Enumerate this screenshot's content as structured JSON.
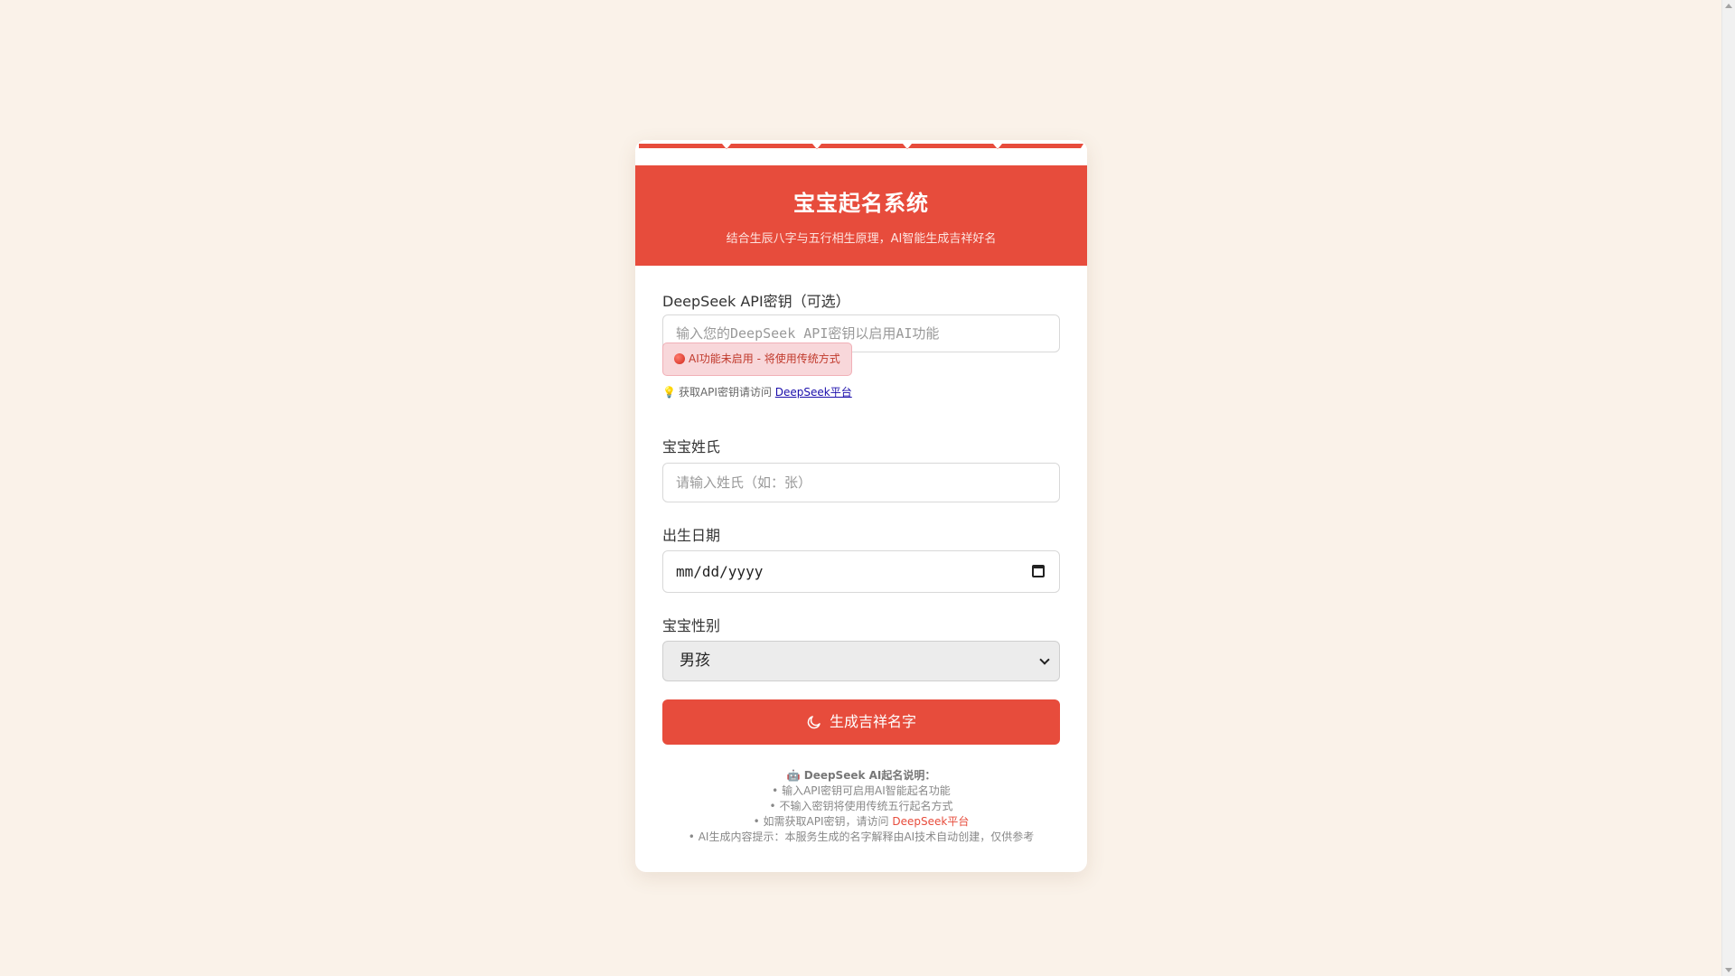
{
  "header": {
    "title": "宝宝起名系统",
    "subtitle": "结合生辰八字与五行相生原理，AI智能生成吉祥好名"
  },
  "api_key": {
    "label": "DeepSeek API密钥（可选）",
    "placeholder": "输入您的DeepSeek API密钥以启用AI功能",
    "status_text": "AI功能未启用 - 将使用传统方式",
    "hint_prefix": "获取API密钥请访问",
    "hint_link": "DeepSeek平台"
  },
  "surname": {
    "label": "宝宝姓氏",
    "placeholder": "请输入姓氏（如：张）"
  },
  "birth_date": {
    "label": "出生日期",
    "placeholder": "mm/dd/yyyy"
  },
  "gender": {
    "label": "宝宝性别",
    "selected": "男孩"
  },
  "submit": {
    "label": "生成吉祥名字"
  },
  "notes": {
    "heading": "🤖 DeepSeek AI起名说明：",
    "line1": "• 输入API密钥可启用AI智能起名功能",
    "line2": "• 不输入密钥将使用传统五行起名方式",
    "line3_prefix": "• 如需获取API密钥，请访问",
    "line3_link": "DeepSeek平台",
    "line4": "• AI生成内容提示：本服务生成的名字解释由AI技术自动创建，仅供参考"
  },
  "colors": {
    "accent": "#e74c3c",
    "background": "#faf2e9"
  }
}
